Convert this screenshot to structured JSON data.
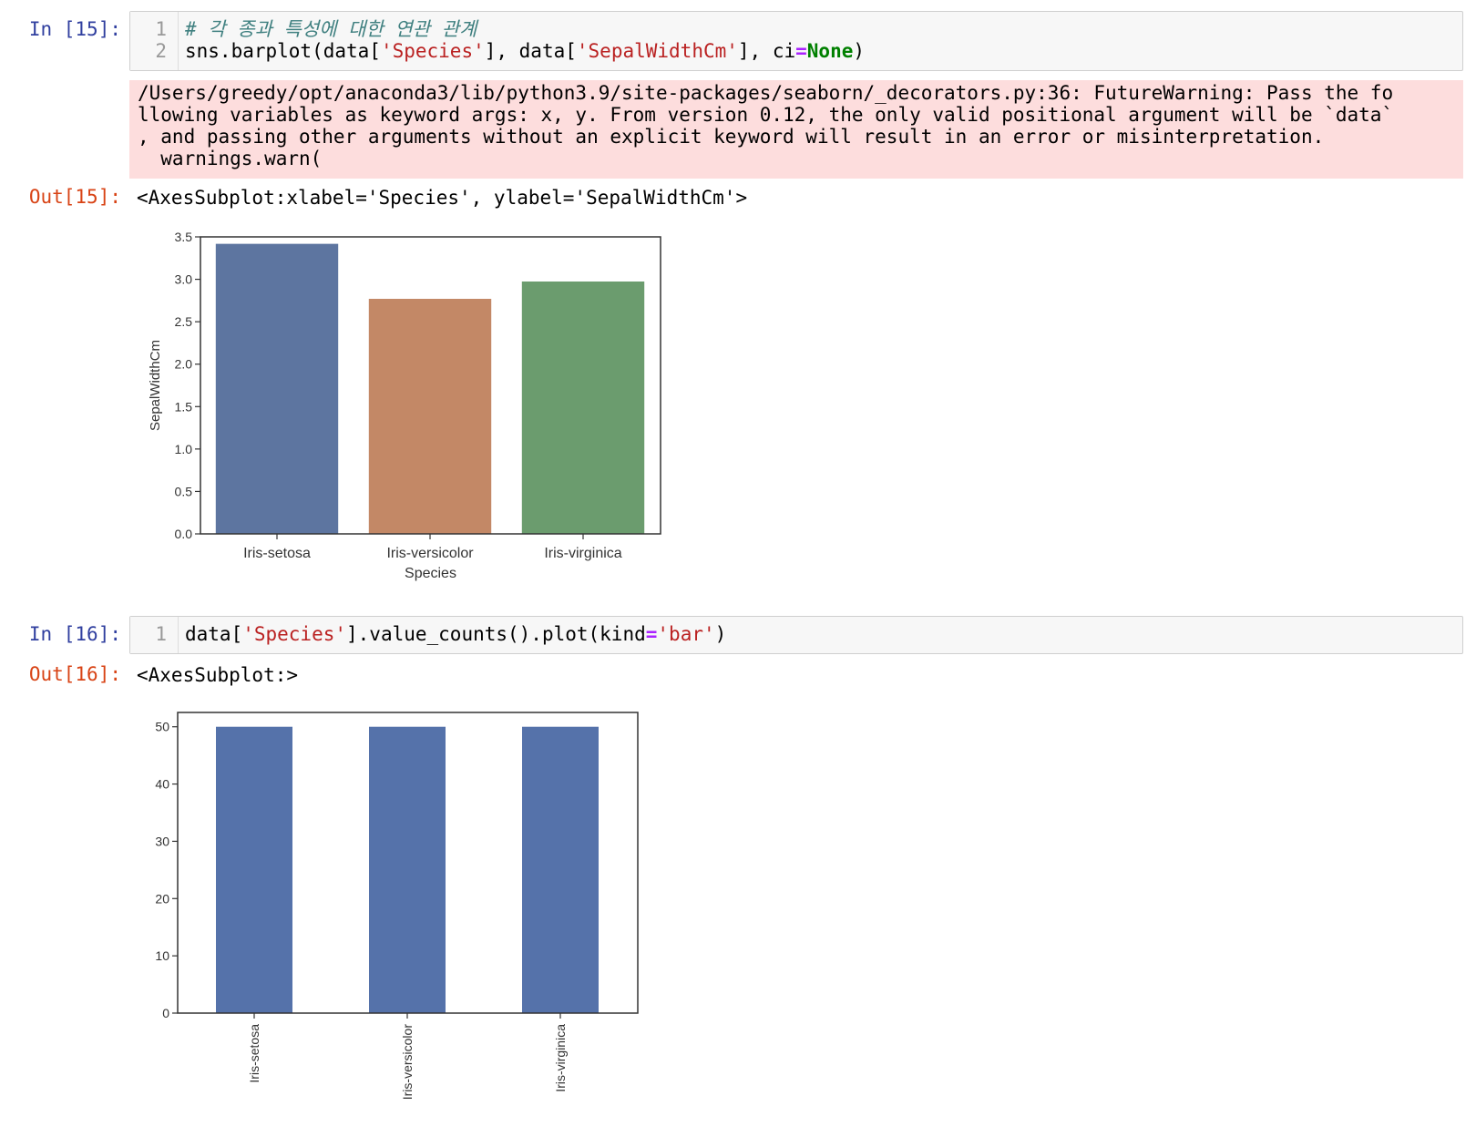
{
  "cell15": {
    "in_prompt": "In [15]:",
    "out_prompt": "Out[15]:",
    "line_numbers": [
      "1",
      "2"
    ],
    "comment_line": "# 각 종과 특성에 대한 연관 관계",
    "code_parts": [
      "sns.barplot(data[",
      "'Species'",
      "], data[",
      "'SepalWidthCm'",
      "], ci",
      "=",
      "None",
      ")"
    ],
    "warning_lines": [
      "/Users/greedy/opt/anaconda3/lib/python3.9/site-packages/seaborn/_decorators.py:36: FutureWarning: Pass the fo",
      "llowing variables as keyword args: x, y. From version 0.12, the only valid positional argument will be `data`",
      ", and passing other arguments without an explicit keyword will result in an error or misinterpretation.",
      "  warnings.warn("
    ],
    "out_text": "<AxesSubplot:xlabel='Species', ylabel='SepalWidthCm'>"
  },
  "cell16": {
    "in_prompt": "In [16]:",
    "out_prompt": "Out[16]:",
    "line_numbers": [
      "1"
    ],
    "code_parts": [
      "data[",
      "'Species'",
      "].value_counts().plot(kind",
      "=",
      "'bar'",
      ")"
    ],
    "out_text": "<AxesSubplot:>"
  },
  "chart_data": [
    {
      "type": "bar",
      "categories": [
        "Iris-setosa",
        "Iris-versicolor",
        "Iris-virginica"
      ],
      "values": [
        3.418,
        2.77,
        2.974
      ],
      "colors": [
        "#5d75a0",
        "#c38866",
        "#6b9c6e"
      ],
      "title": "",
      "xlabel": "Species",
      "ylabel": "SepalWidthCm",
      "ylim": [
        0,
        3.5
      ],
      "yticks": [
        "0.0",
        "0.5",
        "1.0",
        "1.5",
        "2.0",
        "2.5",
        "3.0",
        "3.5"
      ],
      "grid": false
    },
    {
      "type": "bar",
      "categories": [
        "Iris-setosa",
        "Iris-versicolor",
        "Iris-virginica"
      ],
      "values": [
        50,
        50,
        50
      ],
      "colors": [
        "#5572aa",
        "#5572aa",
        "#5572aa"
      ],
      "title": "",
      "xlabel": "",
      "ylabel": "",
      "ylim": [
        0,
        52.5
      ],
      "yticks": [
        "0",
        "10",
        "20",
        "30",
        "40",
        "50"
      ],
      "xtick_rotation": "vertical",
      "grid": false
    }
  ]
}
